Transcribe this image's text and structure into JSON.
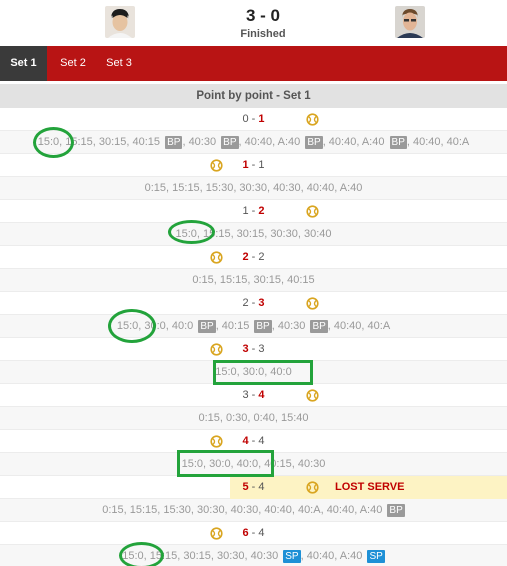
{
  "header": {
    "score": "3 - 0",
    "status": "Finished"
  },
  "tabs": [
    {
      "label": "Set 1",
      "active": true
    },
    {
      "label": "Set 2",
      "active": false
    },
    {
      "label": "Set 3",
      "active": false
    }
  ],
  "section_title": "Point by point - Set 1",
  "rows": [
    {
      "kind": "game",
      "home": "0",
      "away": "1",
      "winner": "away",
      "server": "away"
    },
    {
      "kind": "points",
      "parts": [
        {
          "t": "15:0, 15:15, 30:15, 40:15 "
        },
        {
          "tag": "BP"
        },
        {
          "t": ", 40:30 "
        },
        {
          "tag": "BP"
        },
        {
          "t": ", 40:40, A:40 "
        },
        {
          "tag": "BP"
        },
        {
          "t": ", 40:40, A:40 "
        },
        {
          "tag": "BP"
        },
        {
          "t": ", 40:40, 40:A"
        }
      ]
    },
    {
      "kind": "game",
      "home": "1",
      "away": "1",
      "winner": "home",
      "server": "home"
    },
    {
      "kind": "points",
      "parts": [
        {
          "t": "0:15, 15:15, 15:30, 30:30, 40:30, 40:40, A:40"
        }
      ]
    },
    {
      "kind": "game",
      "home": "1",
      "away": "2",
      "winner": "away",
      "server": "away"
    },
    {
      "kind": "points",
      "parts": [
        {
          "t": "15:0, 15:15, 30:15, 30:30, 30:40"
        }
      ]
    },
    {
      "kind": "game",
      "home": "2",
      "away": "2",
      "winner": "home",
      "server": "home"
    },
    {
      "kind": "points",
      "parts": [
        {
          "t": "0:15, 15:15, 30:15, 40:15"
        }
      ]
    },
    {
      "kind": "game",
      "home": "2",
      "away": "3",
      "winner": "away",
      "server": "away"
    },
    {
      "kind": "points",
      "parts": [
        {
          "t": "15:0, 30:0, 40:0 "
        },
        {
          "tag": "BP"
        },
        {
          "t": ", 40:15 "
        },
        {
          "tag": "BP"
        },
        {
          "t": ", 40:30 "
        },
        {
          "tag": "BP"
        },
        {
          "t": ", 40:40, 40:A"
        }
      ]
    },
    {
      "kind": "game",
      "home": "3",
      "away": "3",
      "winner": "home",
      "server": "home"
    },
    {
      "kind": "points",
      "parts": [
        {
          "t": "15:0, 30:0, 40:0"
        }
      ]
    },
    {
      "kind": "game",
      "home": "3",
      "away": "4",
      "winner": "away",
      "server": "away"
    },
    {
      "kind": "points",
      "parts": [
        {
          "t": "0:15, 0:30, 0:40, 15:40"
        }
      ]
    },
    {
      "kind": "game",
      "home": "4",
      "away": "4",
      "winner": "home",
      "server": "home"
    },
    {
      "kind": "points",
      "parts": [
        {
          "t": "15:0, 30:0, 40:0, 40:15, 40:30"
        }
      ]
    },
    {
      "kind": "game",
      "home": "5",
      "away": "4",
      "winner": "home",
      "server": "away",
      "lost_serve": "LOST SERVE"
    },
    {
      "kind": "points",
      "parts": [
        {
          "t": "0:15, 15:15, 15:30, 30:30, 40:30, 40:40, 40:A, 40:40, A:40 "
        },
        {
          "tag": "BP"
        }
      ]
    },
    {
      "kind": "game",
      "home": "6",
      "away": "4",
      "winner": "home",
      "server": "home"
    },
    {
      "kind": "points",
      "parts": [
        {
          "t": "15:0, 15:15, 30:15, 30:30, 40:30 "
        },
        {
          "tag": "SP"
        },
        {
          "t": ", 40:40, A:40 "
        },
        {
          "tag": "SP"
        }
      ]
    }
  ],
  "colors": {
    "tab_bar": "#b81414",
    "active_tab": "#3a3a3a",
    "winner_score": "#c00000",
    "bp_tag": "#9a9a9a",
    "sp_tag": "#1e90d6",
    "lost_serve_bg": "#fdf3c4",
    "annotation": "#23a33b",
    "ball": "#d9a520"
  }
}
